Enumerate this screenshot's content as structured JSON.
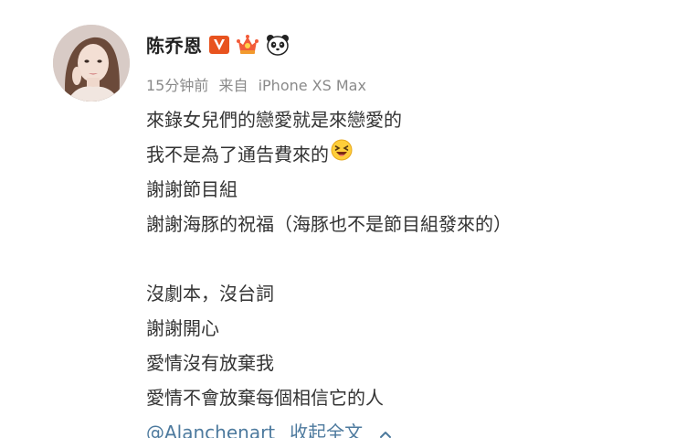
{
  "post": {
    "username": "陈乔恩",
    "time": "15分钟前",
    "source_prefix": "来自",
    "source_device": "iPhone XS Max",
    "lines": {
      "l1": "來錄女兒們的戀愛就是來戀愛的",
      "l2": "我不是為了通告費來的",
      "l3": "謝謝節目組",
      "l4": "謝謝海豚的祝福（海豚也不是節目組發來的）",
      "l5": "沒劇本，沒台詞",
      "l6": "謝謝開心",
      "l7": "愛情沒有放棄我",
      "l8": "愛情不會放棄每個相信它的人"
    },
    "mention": "@Alanchenart",
    "collapse_label": "收起全文"
  },
  "icons": {
    "verified": "vip-v-badge-icon",
    "crown": "crown-level-icon",
    "panda": "panda-icon",
    "laugh": "laughing-emoji-icon",
    "collapse": "chevron-up-icon"
  },
  "colors": {
    "username": "#222222",
    "meta": "#8a8a8a",
    "text": "#333333",
    "link": "#4d7a9e",
    "verified_badge": "#e8531f",
    "crown": "#f25c3a"
  }
}
